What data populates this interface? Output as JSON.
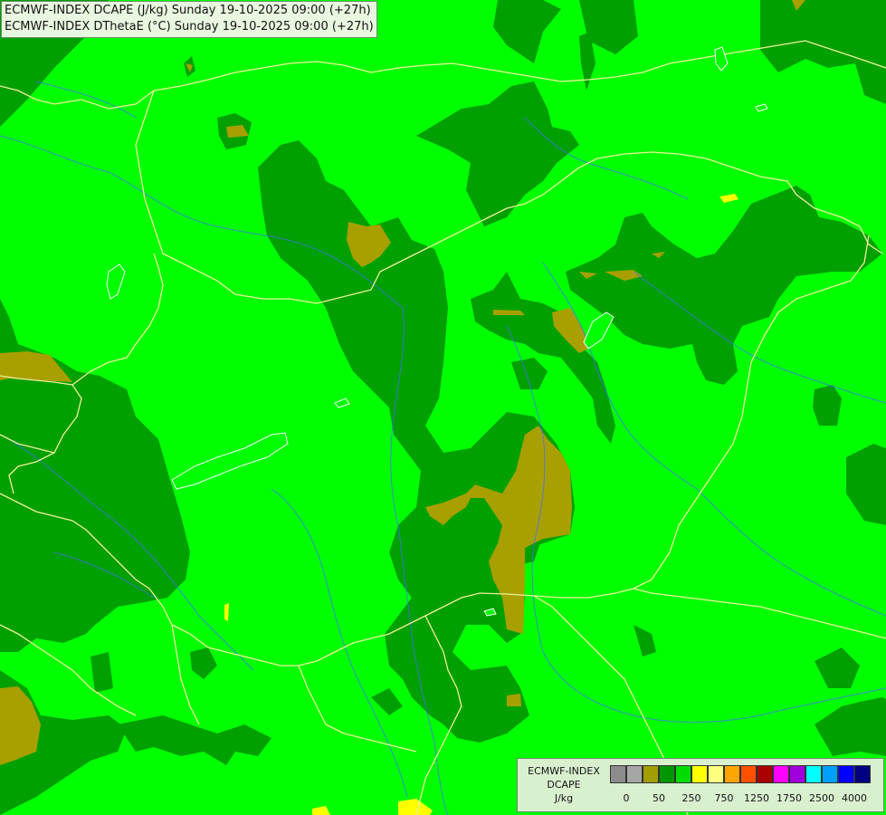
{
  "title": {
    "line1": "ECMWF-INDEX DCAPE (J/kg) Sunday 19-10-2025 09:00 (+27h)",
    "line2": "ECMWF-INDEX DThetaE (°C) Sunday 19-10-2025 09:00 (+27h)"
  },
  "legend": {
    "line1": "ECMWF-INDEX",
    "line2": "DCAPE",
    "line3": "J/kg",
    "swatch_colors": [
      "#8c8c8c",
      "#a6a6a6",
      "#a39e00",
      "#009600",
      "#00dc00",
      "#ffff00",
      "#ffff80",
      "#ffa500",
      "#ff5000",
      "#aa0000",
      "#ff00ff",
      "#a000dc",
      "#00ffff",
      "#00a0ff",
      "#0000ff",
      "#000080"
    ],
    "tick_labels": [
      "0",
      "50",
      "250",
      "750",
      "1250",
      "1750",
      "2500",
      "4000"
    ]
  },
  "colors": {
    "light_green": "#00ff00",
    "dark_green": "#00a000",
    "olive": "#a8a000",
    "yellow": "#ffff00",
    "border": "#f0f0a0",
    "river": "#4a6cff"
  }
}
